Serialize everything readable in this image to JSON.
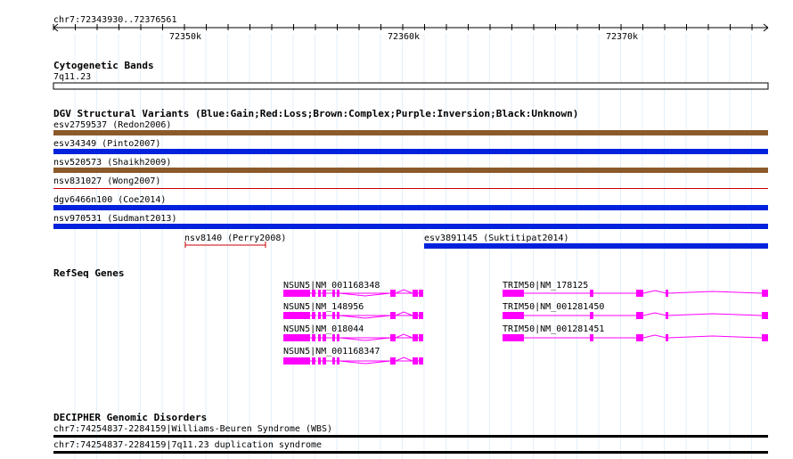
{
  "ruler": {
    "range_label": "chr7:72343930..72376561",
    "ticks": [
      "72350k",
      "72360k",
      "72370k"
    ]
  },
  "tracks": [
    {
      "id": "cytoband",
      "title": "Cytogenetic Bands",
      "band_label": "7q11.23"
    },
    {
      "id": "dgv",
      "title": "DGV Structural Variants (Blue:Gain;Red:Loss;Brown:Complex;Purple:Inversion;Black:Unknown)",
      "features": [
        {
          "label": "esv2759537 (Redon2006)",
          "color": "#8b5a2b"
        },
        {
          "label": "esv34349 (Pinto2007)",
          "color": "#0022dd"
        },
        {
          "label": "nsv520573 (Shaikh2009)",
          "color": "#8b5a2b"
        },
        {
          "label": "nsv831027 (Wong2007)",
          "color": "#cc0000"
        },
        {
          "label": "dgv6466n100 (Coe2014)",
          "color": "#0022dd"
        },
        {
          "label": "nsv970531 (Sudmant2013)",
          "color": "#0022dd"
        },
        {
          "label": "nsv8140 (Perry2008)",
          "color": "#cc0000"
        },
        {
          "label": "esv3891145 (Suktitipat2014)",
          "color": "#0022dd"
        }
      ]
    },
    {
      "id": "refseq",
      "title": "RefSeq Genes",
      "color": "#ff00ff",
      "transcripts": [
        {
          "label": "NSUN5|NM_001168348"
        },
        {
          "label": "NSUN5|NM_148956"
        },
        {
          "label": "NSUN5|NM_018044"
        },
        {
          "label": "NSUN5|NM_001168347"
        },
        {
          "label": "TRIM50|NM_178125"
        },
        {
          "label": "TRIM50|NM_001281450"
        },
        {
          "label": "TRIM50|NM_001281451"
        }
      ]
    },
    {
      "id": "decipher",
      "title": "DECIPHER Genomic Disorders",
      "features": [
        {
          "label": "chr7:74254837-2284159|Williams-Beuren Syndrome (WBS)"
        },
        {
          "label": "chr7:74254837-2284159|7q11.23 duplication syndrome"
        }
      ]
    }
  ]
}
